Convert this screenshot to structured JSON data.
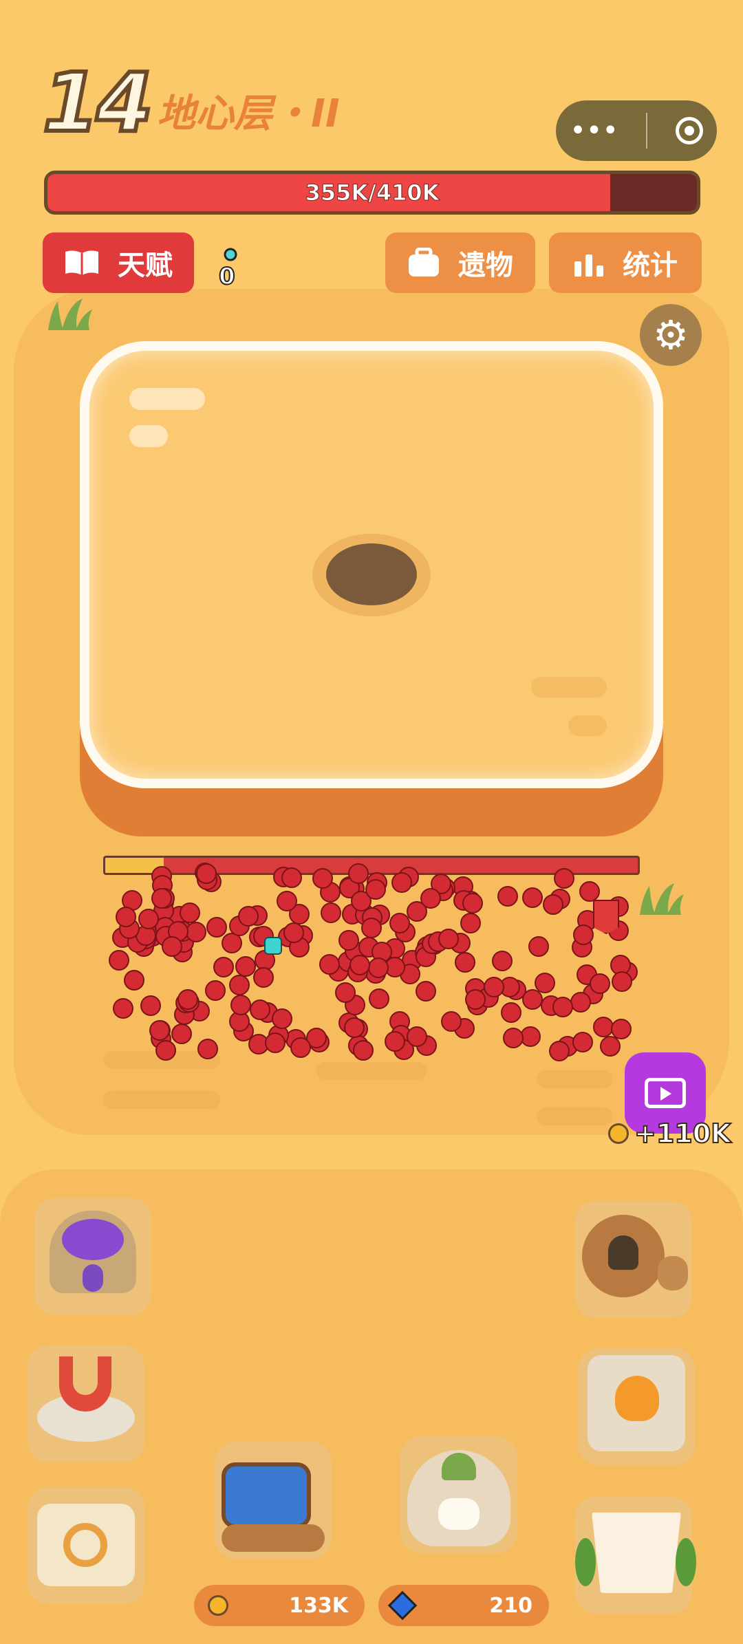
{
  "level": {
    "number": "14",
    "name": "地心层・II"
  },
  "boss_hp": {
    "text": "355K/410K",
    "fraction": 0.866
  },
  "buttons": {
    "talent": "天赋",
    "relic": "遗物",
    "stats": "统计"
  },
  "keys": "0",
  "enemy_wave": {
    "fraction": 0.11
  },
  "ad_reward": "+110K",
  "currency": {
    "coins": "133K",
    "gems": "210"
  },
  "icons": [
    "menu-dots-icon",
    "target-icon",
    "book-icon",
    "key-icon",
    "bag-icon",
    "chart-icon",
    "gear-icon",
    "video-icon",
    "coin-icon",
    "gem-icon"
  ],
  "colors": {
    "background": "#fbc86a",
    "hp_fill": "#ee4545",
    "talent_button": "#e03a3a",
    "secondary_button": "#ed8f45",
    "ad_button": "#b43ae0"
  }
}
